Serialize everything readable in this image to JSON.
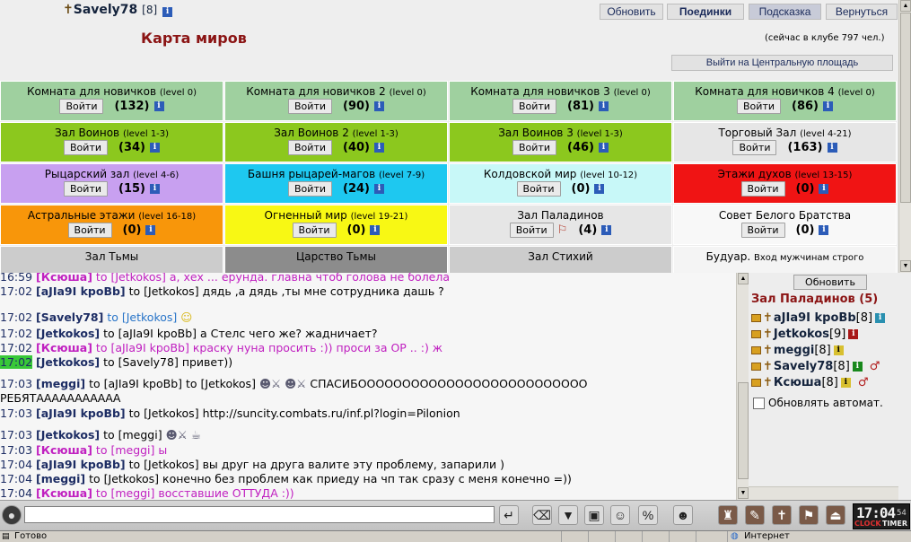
{
  "header": {
    "username": "Savely78",
    "level": "[8]",
    "map_title": "Карта миров",
    "online": "(сейчас в клубе 797 чел.)",
    "exit_label": "Выйти на Центральную площадь",
    "buttons": {
      "refresh": "Обновить",
      "duels": "Поединки",
      "hint": "Подсказка",
      "back": "Вернуться"
    }
  },
  "rooms": [
    {
      "name": "Комната для новичков",
      "level": "(level 0)",
      "enter": "Войти",
      "count": "(132)",
      "bg": "#9fd09f"
    },
    {
      "name": "Комната для новичков 2",
      "level": "(level 0)",
      "enter": "Войти",
      "count": "(90)",
      "bg": "#9fd09f"
    },
    {
      "name": "Комната для новичков 3",
      "level": "(level 0)",
      "enter": "Войти",
      "count": "(81)",
      "bg": "#9fd09f"
    },
    {
      "name": "Комната для новичков 4",
      "level": "(level 0)",
      "enter": "Войти",
      "count": "(86)",
      "bg": "#9fd09f"
    },
    {
      "name": "Зал Воинов",
      "level": "(level 1-3)",
      "enter": "Войти",
      "count": "(34)",
      "bg": "#8cc81e"
    },
    {
      "name": "Зал Воинов 2",
      "level": "(level 1-3)",
      "enter": "Войти",
      "count": "(40)",
      "bg": "#8cc81e"
    },
    {
      "name": "Зал Воинов 3",
      "level": "(level 1-3)",
      "enter": "Войти",
      "count": "(46)",
      "bg": "#8cc81e"
    },
    {
      "name": "Торговый Зал",
      "level": "(level 4-21)",
      "enter": "Войти",
      "count": "(163)",
      "bg": "#e6e6e6"
    },
    {
      "name": "Рыцарский зал",
      "level": "(level 4-6)",
      "enter": "Войти",
      "count": "(15)",
      "bg": "#c8a0f0"
    },
    {
      "name": "Башня рыцарей-магов",
      "level": "(level 7-9)",
      "enter": "Войти",
      "count": "(24)",
      "bg": "#1ec8f0"
    },
    {
      "name": "Колдовской мир",
      "level": "(level 10-12)",
      "enter": "Войти",
      "count": "(0)",
      "bg": "#c8f8f8"
    },
    {
      "name": "Этажи духов",
      "level": "(level 13-15)",
      "enter": "Войти",
      "count": "(0)",
      "bg": "#f01414"
    },
    {
      "name": "Астральные этажи",
      "level": "(level 16-18)",
      "enter": "Войти",
      "count": "(0)",
      "bg": "#f8960a"
    },
    {
      "name": "Огненный мир",
      "level": "(level 19-21)",
      "enter": "Войти",
      "count": "(0)",
      "bg": "#f8f814"
    },
    {
      "name": "Зал Паладинов",
      "level": "",
      "enter": "Войти",
      "count": "(4)",
      "bg": "#e6e6e6"
    },
    {
      "name": "Совет Белого Братства",
      "level": "",
      "enter": "Войти",
      "count": "(0)",
      "bg": "#f8f8f8"
    },
    {
      "name": "Зал Тьмы",
      "level": "",
      "enter": "",
      "count": "",
      "bg": "#cccccc"
    },
    {
      "name": "Царство Тьмы",
      "level": "",
      "enter": "",
      "count": "",
      "bg": "#8c8c8c"
    },
    {
      "name": "Зал Стихий",
      "level": "",
      "enter": "",
      "count": "",
      "bg": "#cccccc"
    },
    {
      "name": "Будуар.",
      "level": "Вход мужчинам строго",
      "enter": "",
      "count": "",
      "bg": "#f4f4f4"
    }
  ],
  "chat": [
    {
      "time": "16:59",
      "nick": "[Ксюша]",
      "to": "to [Jetkokos]",
      "text": "а, хех ... ерунда. главна чтоб голова не болела",
      "pm": true
    },
    {
      "time": "17:02",
      "nick": "[aJIa9I kpoBb]",
      "to": "to [Jetkokos]",
      "text": "дядь ,а дядь ,ты мне сотрудника дашь ?",
      "pm": false
    },
    {
      "time": "17:02",
      "nick": "[Savely78]",
      "to": "to [Jetkokos]",
      "text": "",
      "pm": false
    },
    {
      "time": "17:02",
      "nick": "[Jetkokos]",
      "to": "to [aJIa9I kpoBb]",
      "text": "а Стелс чего же? жадничает?",
      "pm": false
    },
    {
      "time": "17:02",
      "nick": "[Ксюша]",
      "to": "to [aJIa9I kpoBb]",
      "text": "краску нуна просить :)) проси за ОР .. :) ж",
      "pm": true
    },
    {
      "time": "17:02",
      "nick": "[Jetkokos]",
      "to": "to [Savely78]",
      "text": "привет))",
      "pm": false
    },
    {
      "time": "17:03",
      "nick": "[meggi]",
      "to": "to [aJIa9I kpoBb] to [Jetkokos]",
      "text": "СПАСИБОООООООООООООООООООООООООО",
      "pm": false
    },
    {
      "time": "",
      "nick": "",
      "to": "",
      "text": "РЕБЯТААААААААААА",
      "pm": false
    },
    {
      "time": "17:03",
      "nick": "[aJIa9I kpoBb]",
      "to": "to [Jetkokos]",
      "text": "http://suncity.combats.ru/inf.pl?login=Pilonion",
      "pm": false
    },
    {
      "time": "17:03",
      "nick": "[Jetkokos]",
      "to": "to [meggi]",
      "text": "",
      "pm": false
    },
    {
      "time": "17:03",
      "nick": "[Ксюша]",
      "to": "to [meggi]",
      "text": "ы",
      "pm": true
    },
    {
      "time": "17:04",
      "nick": "[aJIa9I kpoBb]",
      "to": "to [Jetkokos]",
      "text": "вы друг на друга валите эту проблему, запарили )",
      "pm": false
    },
    {
      "time": "17:04",
      "nick": "[meggi]",
      "to": "to [Jetkokos]",
      "text": "конечно без проблем как приеду на чп так сразу с меня конечно =))",
      "pm": false
    },
    {
      "time": "17:04",
      "nick": "[Ксюша]",
      "to": "to [meggi]",
      "text": "восставшие ОТТУДА :))",
      "pm": true
    }
  ],
  "sidebar": {
    "refresh": "Обновить",
    "room": "Зал Паладинов (5)",
    "users": [
      {
        "name": "aJIa9I kpoBb",
        "level": "[8]",
        "badge": "tel"
      },
      {
        "name": "Jetkokos",
        "level": "[9]",
        "badge": "red"
      },
      {
        "name": "meggi",
        "level": "[8]",
        "badge": "yel"
      },
      {
        "name": "Savely78",
        "level": "[8]",
        "badge": "grn"
      },
      {
        "name": "Ксюша",
        "level": "[8]",
        "badge": "yel"
      }
    ],
    "auto_refresh": "Обновлять автомат."
  },
  "toolbar": {
    "clock": "17:04",
    "clock_sec": "54",
    "clock_label": "CLOCK",
    "timer_label": "TIMER"
  },
  "status": {
    "left": "Готово",
    "zone": "Интернет"
  }
}
